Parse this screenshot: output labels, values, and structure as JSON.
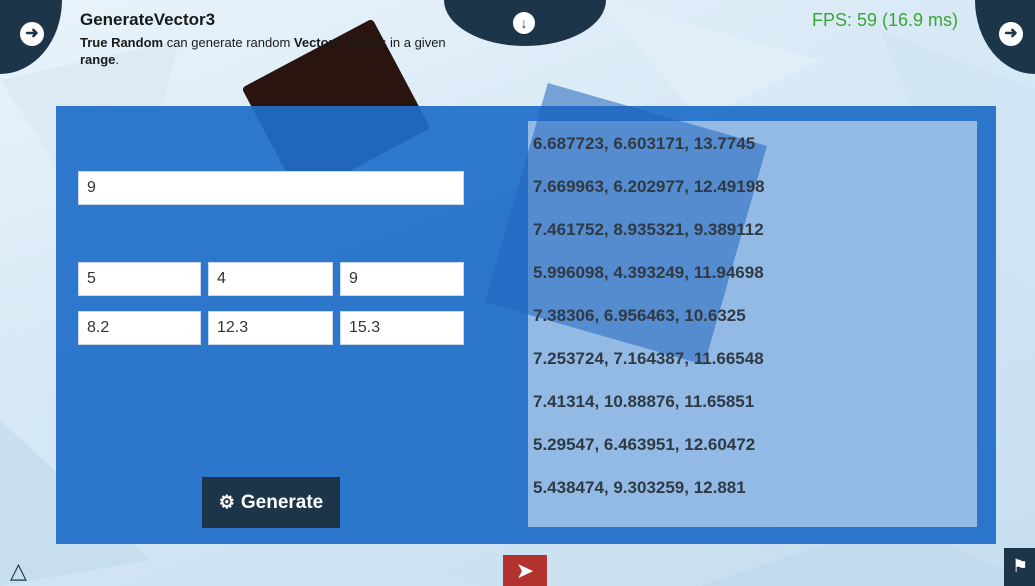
{
  "header": {
    "title": "GenerateVector3",
    "description_parts": [
      "True Random",
      " can generate random ",
      "Vector3",
      "-objects in a given ",
      "range",
      "."
    ],
    "fps": "FPS: 59 (16.9 ms)"
  },
  "nav": {
    "back_icon": "arrow-left-circle-icon",
    "forward_icon": "arrow-right-circle-icon",
    "down_icon": "arrow-down-circle-icon"
  },
  "form": {
    "count_value": "9",
    "min_values": [
      "5",
      "4",
      "9"
    ],
    "max_values": [
      "8.2",
      "12.3",
      "15.3"
    ],
    "generate_label": "Generate"
  },
  "results": [
    "6.687723, 6.603171, 13.7745",
    "7.669963, 6.202977, 12.49198",
    "7.461752, 8.935321, 9.389112",
    "5.996098, 4.393249, 11.94698",
    "7.38306, 6.956463, 10.6325",
    "7.253724, 7.164387, 11.66548",
    "7.41314, 10.88876, 11.65851",
    "5.29547, 6.463951, 12.60472",
    "5.438474, 9.303259, 12.881"
  ],
  "colors": {
    "panel": "#1f6ec8",
    "dark": "#1d3549",
    "fps": "#3aa536",
    "exit": "#b3322d"
  }
}
